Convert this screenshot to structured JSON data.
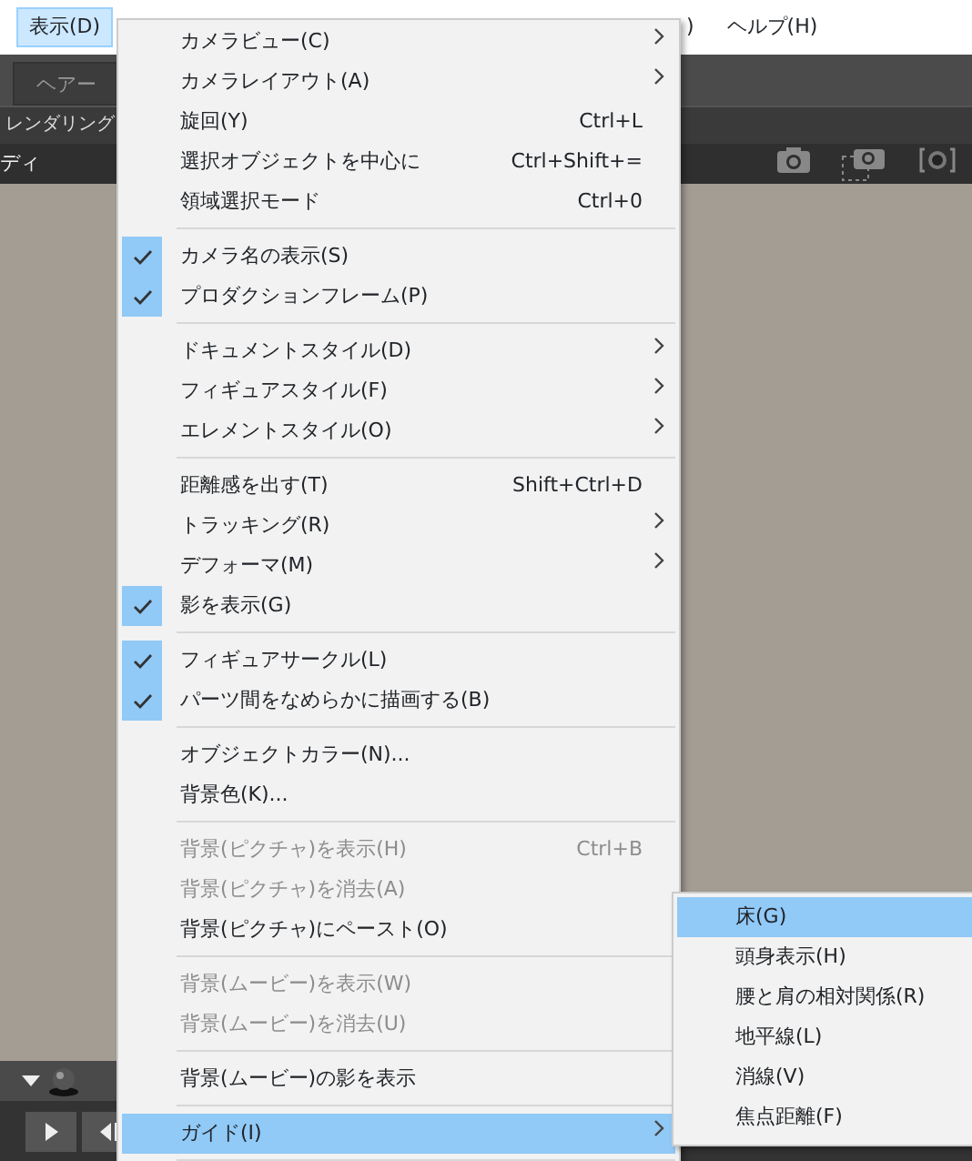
{
  "menubar": [
    {
      "label": "表示(D)",
      "selected": true
    },
    {
      "label": ")",
      "selected": false
    },
    {
      "label": "ヘルプ(H)",
      "selected": false
    }
  ],
  "app": {
    "tab": "ヘアー",
    "tab_row2": "レンダリング",
    "panel_label": "ディ"
  },
  "menu": [
    {
      "kind": "item",
      "label": "カメラビュー(C)",
      "submenu": true,
      "checked": false,
      "disabled": false,
      "selected": false
    },
    {
      "kind": "item",
      "label": "カメラレイアウト(A)",
      "submenu": true,
      "checked": false,
      "disabled": false,
      "selected": false
    },
    {
      "kind": "item",
      "label": "旋回(Y)",
      "shortcut": "Ctrl+L",
      "submenu": false,
      "checked": false,
      "disabled": false,
      "selected": false
    },
    {
      "kind": "item",
      "label": "選択オブジェクトを中心に",
      "shortcut": "Ctrl+Shift+=",
      "submenu": false,
      "checked": false,
      "disabled": false,
      "selected": false
    },
    {
      "kind": "item",
      "label": "領域選択モード",
      "shortcut": "Ctrl+0",
      "submenu": false,
      "checked": false,
      "disabled": false,
      "selected": false
    },
    {
      "kind": "separator"
    },
    {
      "kind": "item",
      "label": "カメラ名の表示(S)",
      "submenu": false,
      "checked": true,
      "disabled": false,
      "selected": false
    },
    {
      "kind": "item",
      "label": "プロダクションフレーム(P)",
      "submenu": false,
      "checked": true,
      "disabled": false,
      "selected": false
    },
    {
      "kind": "separator"
    },
    {
      "kind": "item",
      "label": "ドキュメントスタイル(D)",
      "submenu": true,
      "checked": false,
      "disabled": false,
      "selected": false
    },
    {
      "kind": "item",
      "label": "フィギュアスタイル(F)",
      "submenu": true,
      "checked": false,
      "disabled": false,
      "selected": false
    },
    {
      "kind": "item",
      "label": "エレメントスタイル(O)",
      "submenu": true,
      "checked": false,
      "disabled": false,
      "selected": false
    },
    {
      "kind": "separator"
    },
    {
      "kind": "item",
      "label": "距離感を出す(T)",
      "shortcut": "Shift+Ctrl+D",
      "submenu": false,
      "checked": false,
      "disabled": false,
      "selected": false
    },
    {
      "kind": "item",
      "label": "トラッキング(R)",
      "submenu": true,
      "checked": false,
      "disabled": false,
      "selected": false
    },
    {
      "kind": "item",
      "label": "デフォーマ(M)",
      "submenu": true,
      "checked": false,
      "disabled": false,
      "selected": false
    },
    {
      "kind": "item",
      "label": "影を表示(G)",
      "submenu": false,
      "checked": true,
      "disabled": false,
      "selected": false
    },
    {
      "kind": "separator"
    },
    {
      "kind": "item",
      "label": "フィギュアサークル(L)",
      "submenu": false,
      "checked": true,
      "disabled": false,
      "selected": false
    },
    {
      "kind": "item",
      "label": "パーツ間をなめらかに描画する(B)",
      "submenu": false,
      "checked": true,
      "disabled": false,
      "selected": false
    },
    {
      "kind": "separator"
    },
    {
      "kind": "item",
      "label": "オブジェクトカラー(N)...",
      "submenu": false,
      "checked": false,
      "disabled": false,
      "selected": false
    },
    {
      "kind": "item",
      "label": "背景色(K)...",
      "submenu": false,
      "checked": false,
      "disabled": false,
      "selected": false
    },
    {
      "kind": "separator"
    },
    {
      "kind": "item",
      "label": "背景(ピクチャ)を表示(H)",
      "shortcut": "Ctrl+B",
      "submenu": false,
      "checked": false,
      "disabled": true,
      "selected": false
    },
    {
      "kind": "item",
      "label": "背景(ピクチャ)を消去(A)",
      "submenu": false,
      "checked": false,
      "disabled": true,
      "selected": false
    },
    {
      "kind": "item",
      "label": "背景(ピクチャ)にペースト(O)",
      "submenu": false,
      "checked": false,
      "disabled": false,
      "selected": false
    },
    {
      "kind": "separator"
    },
    {
      "kind": "item",
      "label": "背景(ムービー)を表示(W)",
      "submenu": false,
      "checked": false,
      "disabled": true,
      "selected": false
    },
    {
      "kind": "item",
      "label": "背景(ムービー)を消去(U)",
      "submenu": false,
      "checked": false,
      "disabled": true,
      "selected": false
    },
    {
      "kind": "separator"
    },
    {
      "kind": "item",
      "label": "背景(ムービー)の影を表示",
      "submenu": false,
      "checked": false,
      "disabled": false,
      "selected": false
    },
    {
      "kind": "separator"
    },
    {
      "kind": "item",
      "label": "ガイド(I)",
      "submenu": true,
      "checked": false,
      "disabled": false,
      "selected": true
    },
    {
      "kind": "separator"
    }
  ],
  "submenu": [
    {
      "label": "床(G)",
      "selected": true
    },
    {
      "label": "頭身表示(H)",
      "selected": false
    },
    {
      "label": "腰と肩の相対関係(R)",
      "selected": false
    },
    {
      "label": "地平線(L)",
      "selected": false
    },
    {
      "label": "消線(V)",
      "selected": false
    },
    {
      "label": "焦点距離(F)",
      "selected": false
    }
  ]
}
